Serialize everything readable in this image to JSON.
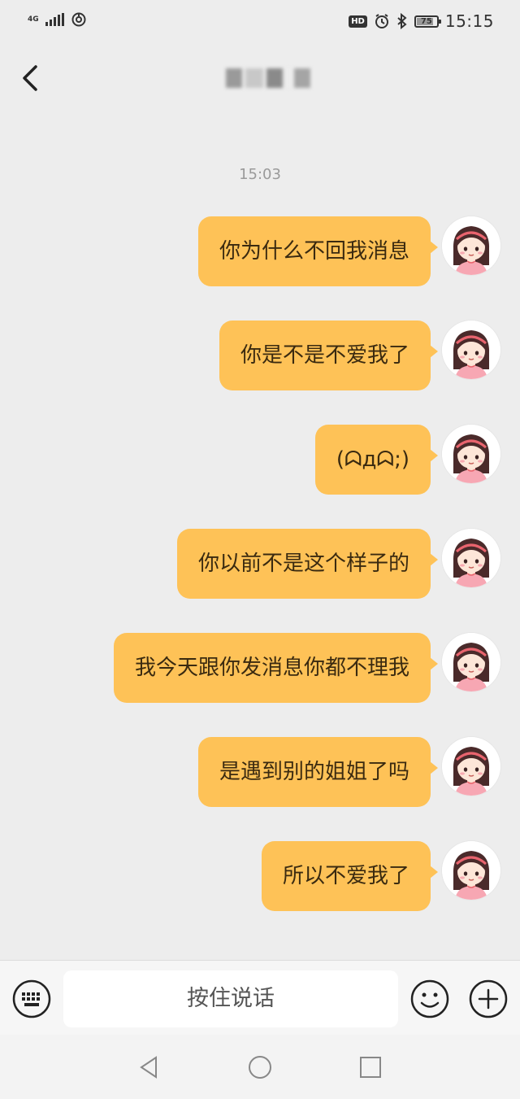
{
  "status_bar": {
    "network_label": "4G",
    "clock": "15:15",
    "battery_level": "75",
    "hd_label": "HD",
    "icons": [
      "signal-icon",
      "hotspot-icon",
      "alarm-icon",
      "bluetooth-icon",
      "battery-icon"
    ]
  },
  "header": {
    "back_icon": "chevron-left-icon",
    "title_blurred": true
  },
  "conversation": {
    "timestamp": "15:03",
    "messages": [
      {
        "text": "你为什么不回我消息",
        "sender": "self"
      },
      {
        "text": "你是不是不爱我了",
        "sender": "self"
      },
      {
        "text": "(ᗣдᗣ;)",
        "sender": "self"
      },
      {
        "text": "你以前不是这个样子的",
        "sender": "self"
      },
      {
        "text": "我今天跟你发消息你都不理我",
        "sender": "self"
      },
      {
        "text": "是遇到别的姐姐了吗",
        "sender": "self"
      },
      {
        "text": "所以不爱我了",
        "sender": "self"
      }
    ],
    "bubble_color": "#fec257"
  },
  "input_bar": {
    "voice_button_label": "按住说话",
    "icons": [
      "keyboard-icon",
      "emoji-icon",
      "plus-icon"
    ]
  },
  "nav_bar": {
    "icons": [
      "back-triangle-icon",
      "home-circle-icon",
      "recents-square-icon"
    ]
  }
}
